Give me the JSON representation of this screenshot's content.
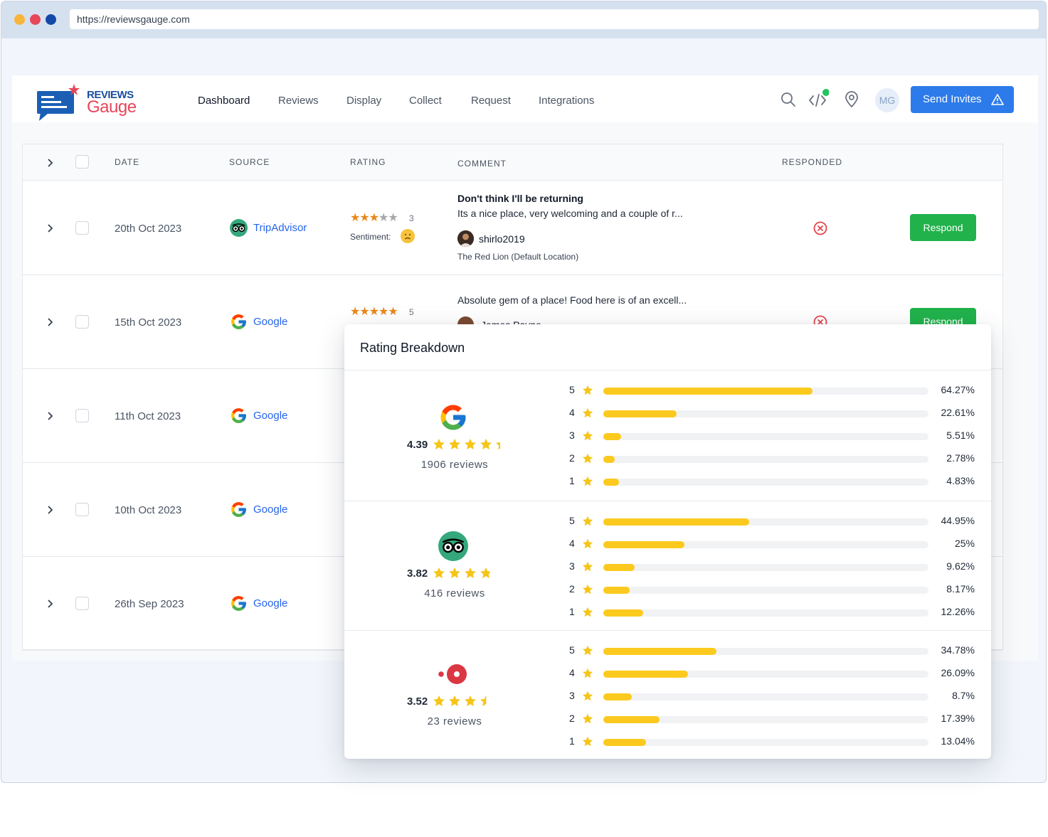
{
  "browser": {
    "url": "https://reviewsgauge.com"
  },
  "logo": {
    "line1": "REVIEWS",
    "line2": "Gauge"
  },
  "nav": {
    "items": [
      "Dashboard",
      "Reviews",
      "Display",
      "Collect",
      "Request",
      "Integrations"
    ],
    "active": "Dashboard",
    "avatar": "MG",
    "send_invites": "Send Invites"
  },
  "table": {
    "headers": {
      "date": "DATE",
      "source": "SOURCE",
      "rating": "RATING",
      "comment": "COMMENT",
      "responded": "RESPONDED"
    },
    "sentiment_label": "Sentiment:",
    "respond_label": "Respond",
    "rows": [
      {
        "date": "20th Oct 2023",
        "source": "TripAdvisor",
        "rating": 3,
        "rating_text": "3",
        "title": "Don't think I'll be returning",
        "text": "Its a nice place, very welcoming and a couple of r...",
        "user": "shirlo2019",
        "location": "The Red Lion (Default Location)"
      },
      {
        "date": "15th Oct 2023",
        "source": "Google",
        "rating": 5,
        "rating_text": "5",
        "text": "Absolute gem of a place! Food here is of an excell...",
        "user": "James Payne"
      },
      {
        "date": "11th Oct 2023",
        "source": "Google"
      },
      {
        "date": "10th Oct 2023",
        "source": "Google"
      },
      {
        "date": "26th Sep 2023",
        "source": "Google"
      }
    ]
  },
  "breakdown": {
    "title": "Rating Breakdown",
    "platforms": [
      {
        "icon": "google-icon",
        "score": "4.39",
        "stars": 4.39,
        "reviews": "1906 reviews",
        "rows": [
          {
            "stars": "5",
            "pct": "64.27%",
            "value": 64.27
          },
          {
            "stars": "4",
            "pct": "22.61%",
            "value": 22.61
          },
          {
            "stars": "3",
            "pct": "5.51%",
            "value": 5.51
          },
          {
            "stars": "2",
            "pct": "2.78%",
            "value": 2.78
          },
          {
            "stars": "1",
            "pct": "4.83%",
            "value": 4.83
          }
        ]
      },
      {
        "icon": "tripadvisor-icon",
        "score": "3.82",
        "stars": 3.82,
        "reviews": "416 reviews",
        "rows": [
          {
            "stars": "5",
            "pct": "44.95%",
            "value": 44.95
          },
          {
            "stars": "4",
            "pct": "25%",
            "value": 25
          },
          {
            "stars": "3",
            "pct": "9.62%",
            "value": 9.62
          },
          {
            "stars": "2",
            "pct": "8.17%",
            "value": 8.17
          },
          {
            "stars": "1",
            "pct": "12.26%",
            "value": 12.26
          }
        ]
      },
      {
        "icon": "opentable-icon",
        "score": "3.52",
        "stars": 3.52,
        "reviews": "23 reviews",
        "rows": [
          {
            "stars": "5",
            "pct": "34.78%",
            "value": 34.78
          },
          {
            "stars": "4",
            "pct": "26.09%",
            "value": 26.09
          },
          {
            "stars": "3",
            "pct": "8.7%",
            "value": 8.7
          },
          {
            "stars": "2",
            "pct": "17.39%",
            "value": 17.39
          },
          {
            "stars": "1",
            "pct": "13.04%",
            "value": 13.04
          }
        ]
      }
    ]
  },
  "colors": {
    "accent": "#2d7bea",
    "respond": "#21b24b",
    "bar": "#fcca1e",
    "star": "#f5c518",
    "rating_star": "#e9871a",
    "status_dot": "#21c55d",
    "not_responded": "#e2434b"
  }
}
